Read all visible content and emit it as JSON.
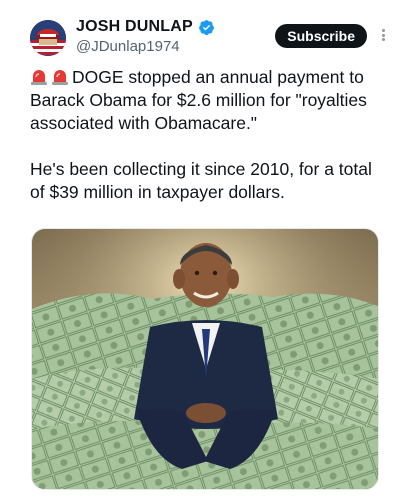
{
  "author": {
    "display_name": "JOSH DUNLAP",
    "handle": "@JDunlap1974",
    "avatar_icon": "avatar-flag-hat",
    "verified_icon": "verified-badge-icon"
  },
  "actions": {
    "subscribe_label": "Subscribe",
    "more_icon": "more-vertical-icon"
  },
  "tweet": {
    "emoji": "police-siren-icon",
    "line1": "DOGE stopped an annual payment to Barack Obama for $2.6 million for \"royalties associated with Obamacare.\"",
    "line2": "He's been collecting it since 2010, for a total of $39 million in taxpayer dollars."
  },
  "media": {
    "type": "image",
    "subject": "man-sitting-in-pile-of-cash-illustration"
  },
  "colors": {
    "text": "#0f1419",
    "secondary": "#536471",
    "verified": "#1d9bf0",
    "subscribe_bg": "#0f1419"
  }
}
